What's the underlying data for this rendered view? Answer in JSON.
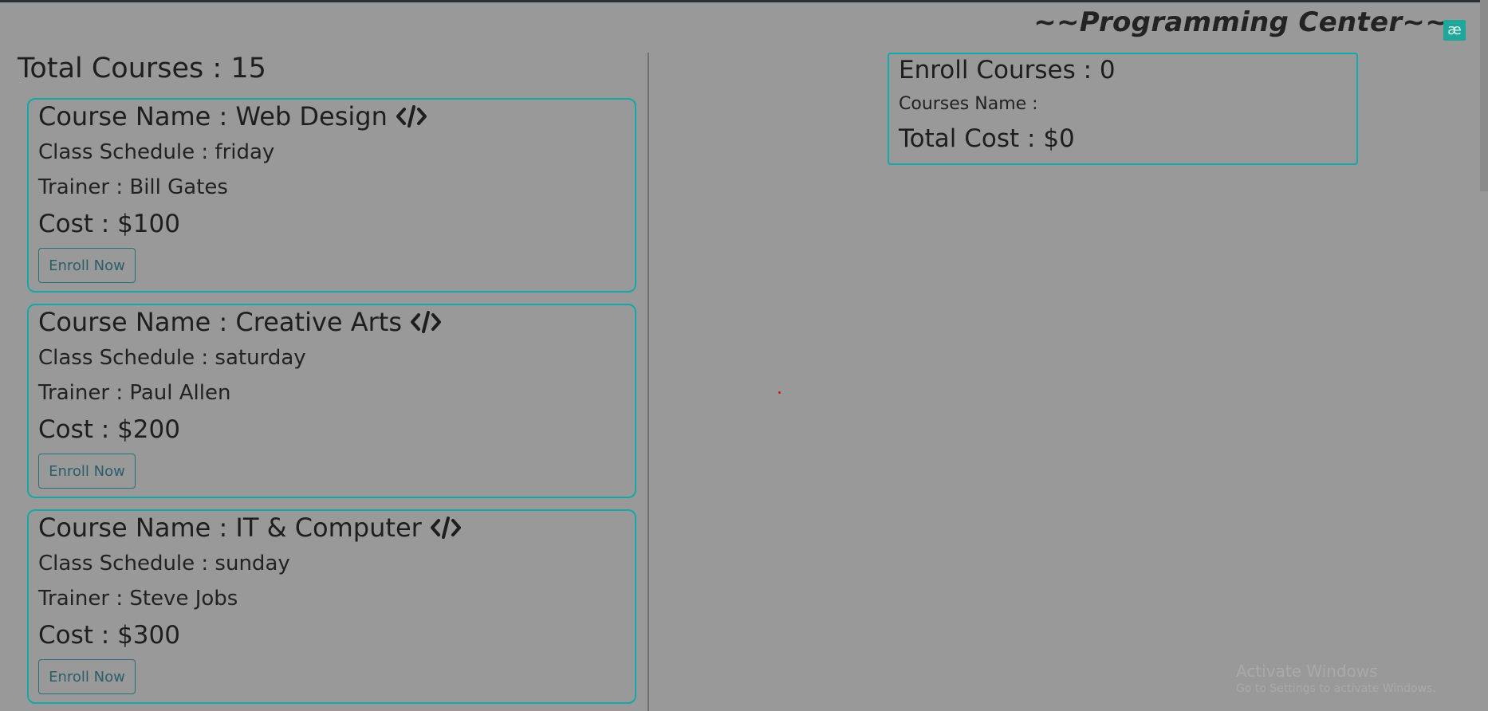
{
  "header": {
    "brand_title": "~~Programming Center~~",
    "extension_badge": "æ"
  },
  "courses": {
    "total_label": "Total Courses : 15",
    "items": [
      {
        "name": "Course Name : Web Design",
        "schedule": "Class Schedule : friday",
        "trainer": "Trainer : Bill Gates",
        "cost": "Cost : $100",
        "button_label": "Enroll Now",
        "icon": "code-icon"
      },
      {
        "name": "Course Name : Creative Arts",
        "schedule": "Class Schedule : saturday",
        "trainer": "Trainer : Paul Allen",
        "cost": "Cost : $200",
        "button_label": "Enroll Now",
        "icon": "code-icon"
      },
      {
        "name": "Course Name : IT & Computer",
        "schedule": "Class Schedule : sunday",
        "trainer": "Trainer : Steve Jobs",
        "cost": "Cost : $300",
        "button_label": "Enroll Now",
        "icon": "code-icon"
      }
    ]
  },
  "enroll_panel": {
    "title": "Enroll Courses : 0",
    "names_label": "Courses Name :",
    "total_cost": "Total Cost : $0"
  },
  "watermark": {
    "line1": "Activate Windows",
    "line2": "Go to Settings to activate Windows."
  },
  "colors": {
    "background": "#999999",
    "accent_border": "#14a8a8",
    "button_text": "#2a5e6b"
  }
}
